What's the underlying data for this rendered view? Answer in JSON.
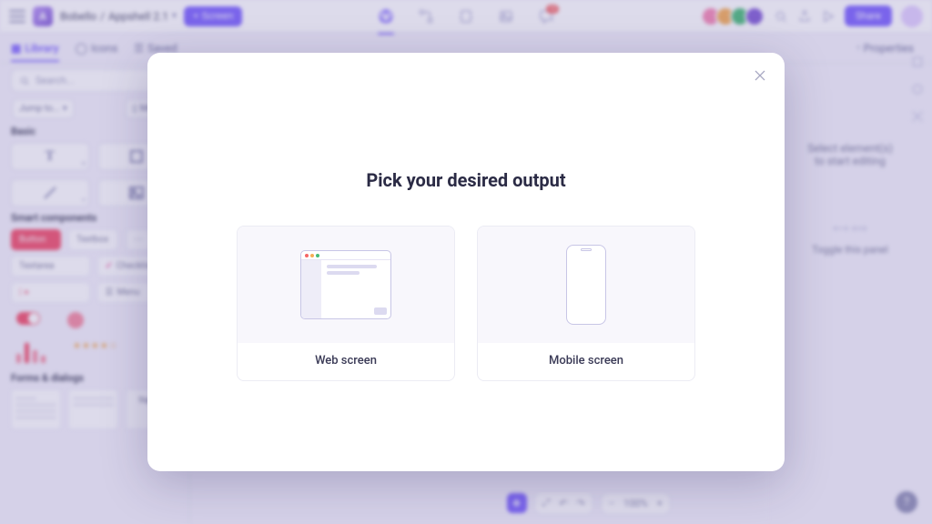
{
  "topbar": {
    "org": "Bobello",
    "project": "Appshell 2.1",
    "addScreenLabel": "+ Screen",
    "shareLabel": "Share",
    "messagesBadge": "12"
  },
  "subbar": {
    "tabs": {
      "library": "Library",
      "icons": "Icons",
      "saved": "Saved"
    },
    "propertiesLabel": "Properties"
  },
  "leftPane": {
    "searchPlaceholder": "Search...",
    "jumpTo": "Jump to...",
    "mobile": "Mobile",
    "sections": {
      "basic": "Basic",
      "smart": "Smart components",
      "forms": "Forms & dialogs"
    },
    "components": {
      "button": "Button",
      "textbox": "Textbox",
      "textarea": "Textarea",
      "checklist": "Checklist",
      "menu": "Menu",
      "tabs": "Tabs",
      "signup": "Sign up"
    }
  },
  "rightPane": {
    "hintLine1": "Select element(s)",
    "hintLine2": "to start editing",
    "toggleHint": "Toggle this panel",
    "align": "⟷  ⟺"
  },
  "bottomToolbar": {
    "zoom": "100%"
  },
  "modal": {
    "title": "Pick your desired output",
    "options": {
      "web": "Web screen",
      "mobile": "Mobile screen"
    }
  }
}
